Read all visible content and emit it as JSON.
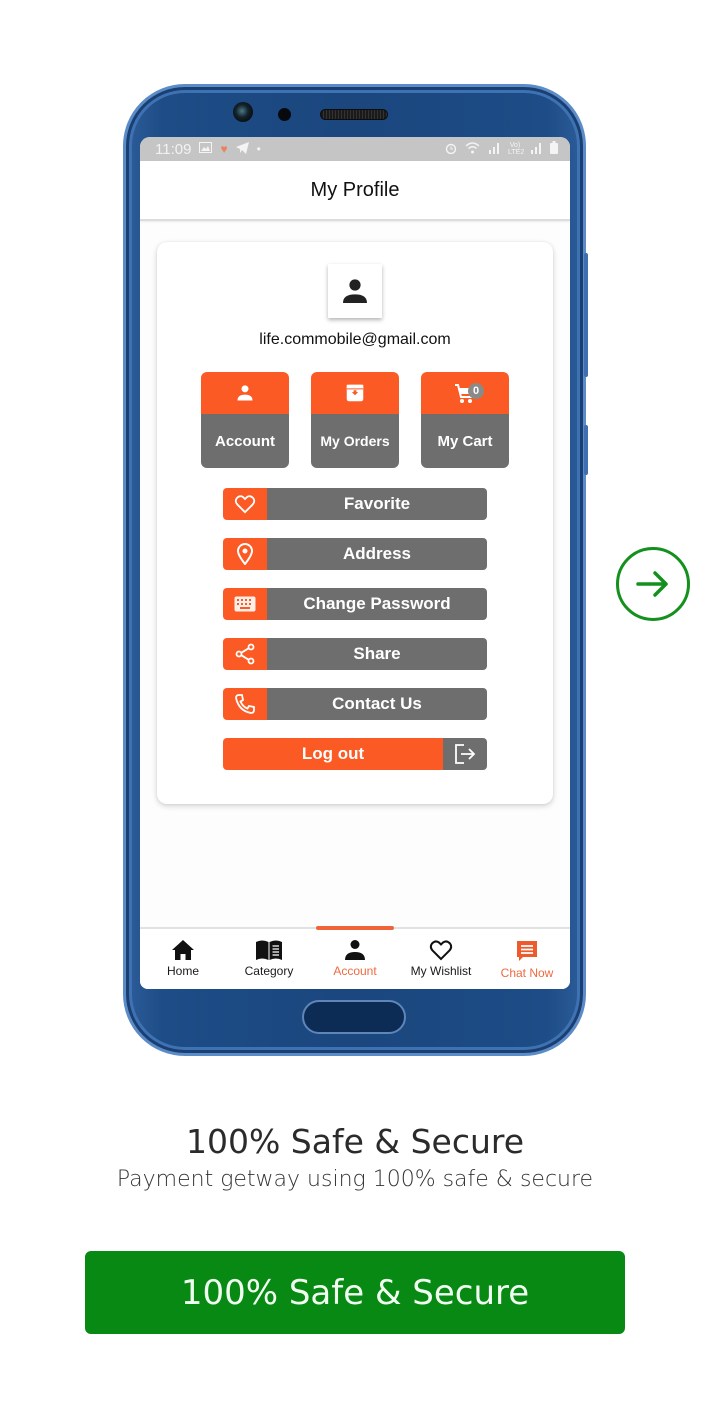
{
  "status_bar": {
    "time": "11:09",
    "left_icons": [
      "gallery-icon",
      "heart-icon",
      "telegram-icon",
      "dot-icon"
    ],
    "right_icons": [
      "alarm-icon",
      "wifi-icon",
      "signal-icon",
      "volte-icon",
      "signal-icon",
      "battery-icon"
    ],
    "volte_text": "Vo) LTE2"
  },
  "header": {
    "title": "My Profile"
  },
  "profile": {
    "avatar_icon": "person-icon",
    "email": "life.commobile@gmail.com"
  },
  "tiles": [
    {
      "label": "Account",
      "icon": "person-icon"
    },
    {
      "label": "My Orders",
      "icon": "archive-icon"
    },
    {
      "label": "My Cart",
      "icon": "cart-icon",
      "badge": "0"
    }
  ],
  "menu": [
    {
      "label": "Favorite",
      "icon": "heart-outline-icon"
    },
    {
      "label": "Address",
      "icon": "location-pin-icon"
    },
    {
      "label": "Change Password",
      "icon": "keyboard-icon"
    },
    {
      "label": "Share",
      "icon": "share-icon"
    },
    {
      "label": "Contact Us",
      "icon": "phone-icon"
    }
  ],
  "logout": {
    "label": "Log out",
    "icon": "logout-icon"
  },
  "bottom_nav": {
    "active": "Account",
    "items": [
      {
        "label": "Home",
        "icon": "home-icon"
      },
      {
        "label": "Category",
        "icon": "book-icon"
      },
      {
        "label": "Account",
        "icon": "person-icon"
      },
      {
        "label": "My Wishlist",
        "icon": "heart-outline-icon"
      },
      {
        "label": "Chat Now",
        "icon": "chat-icon"
      }
    ]
  },
  "promo": {
    "title": "100% Safe & Secure",
    "subtitle": "Payment getway using 100% safe & secure",
    "cta_label": "100% Safe & Secure",
    "next_icon": "arrow-right-circle-icon"
  },
  "colors": {
    "accent_orange": "#fc5a24",
    "tile_gray": "#6e6e6e",
    "green": "#078913",
    "phone_blue": "#1b467e"
  }
}
